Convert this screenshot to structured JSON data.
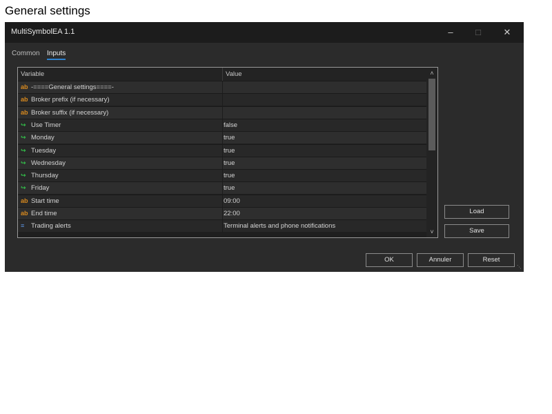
{
  "page_caption": "General settings",
  "window": {
    "title": "MultiSymbolEA 1.1",
    "minimize_glyph": "–",
    "maximize_glyph": "□",
    "close_glyph": "✕"
  },
  "tabs": [
    {
      "label": "Common",
      "active": false
    },
    {
      "label": "Inputs",
      "active": true
    }
  ],
  "grid": {
    "headers": {
      "variable": "Variable",
      "value": "Value"
    },
    "rows": [
      {
        "icon": "ab",
        "variable": "-====General settings====-",
        "value": ""
      },
      {
        "icon": "ab",
        "variable": "Broker prefix (if necessary)",
        "value": ""
      },
      {
        "icon": "ab",
        "variable": "Broker suffix (if necessary)",
        "value": ""
      },
      {
        "icon": "bool",
        "variable": "Use Timer",
        "value": "false"
      },
      {
        "icon": "bool",
        "variable": "Monday",
        "value": "true"
      },
      {
        "icon": "bool",
        "variable": "Tuesday",
        "value": "true"
      },
      {
        "icon": "bool",
        "variable": "Wednesday",
        "value": "true"
      },
      {
        "icon": "bool",
        "variable": "Thursday",
        "value": "true"
      },
      {
        "icon": "bool",
        "variable": "Friday",
        "value": "true"
      },
      {
        "icon": "ab",
        "variable": "Start time",
        "value": "09:00"
      },
      {
        "icon": "ab",
        "variable": "End time",
        "value": "22:00"
      },
      {
        "icon": "enum",
        "variable": "Trading alerts",
        "value": "Terminal alerts and phone notifications"
      }
    ],
    "icon_glyphs": {
      "ab": "ab",
      "bool": "↪",
      "enum": "≡"
    },
    "scroll_up_glyph": "˄",
    "scroll_down_glyph": "˅"
  },
  "side_buttons": {
    "load_label": "Load",
    "save_label": "Save"
  },
  "footer_buttons": {
    "ok_label": "OK",
    "cancel_label": "Annuler",
    "reset_label": "Reset"
  },
  "colors": {
    "window_bg": "#2b2b2b",
    "titlebar_bg": "#1c1c1c",
    "accent": "#2f83d0",
    "string_icon": "#d98a1e",
    "bool_icon": "#33c04a",
    "enum_icon": "#5b8fd8"
  }
}
